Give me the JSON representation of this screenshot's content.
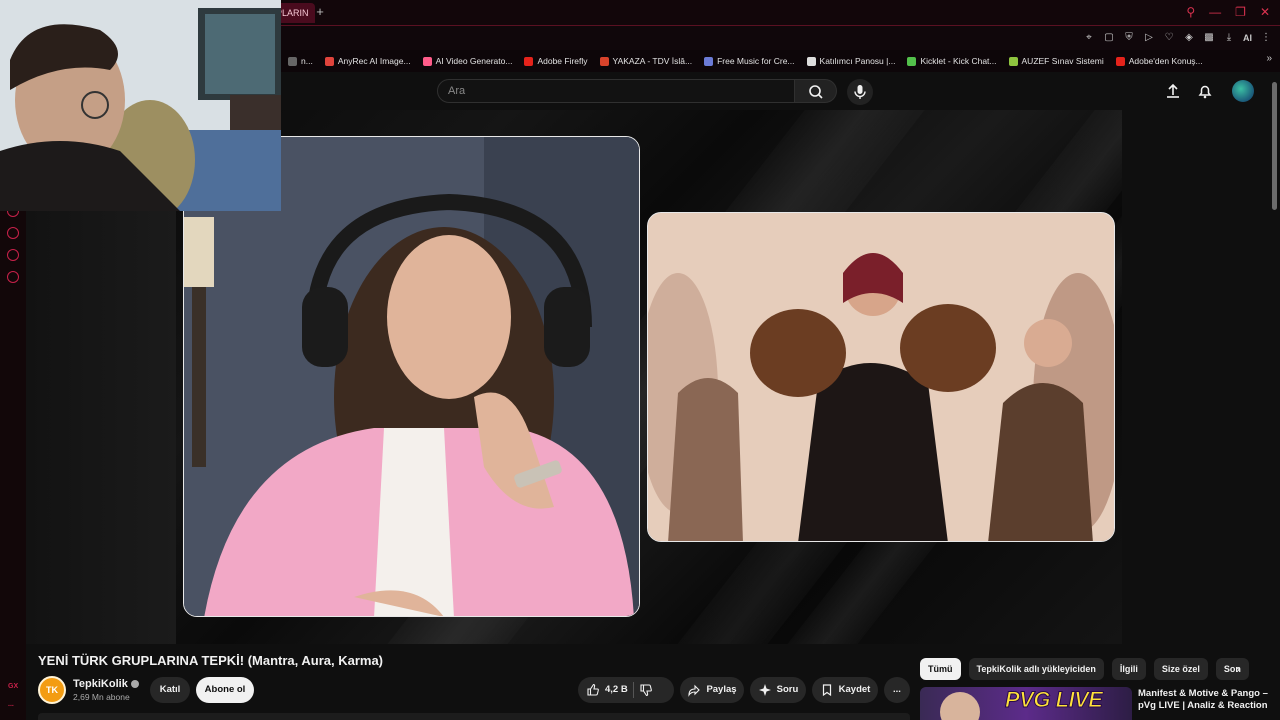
{
  "browser": {
    "active_tab_label": "PLARIN",
    "new_tab_label": "+",
    "bookmarks": [
      {
        "label": "n...",
        "color": "#666666"
      },
      {
        "label": "AnyRec AI Image...",
        "color": "#e0443c"
      },
      {
        "label": "AI Video Generato...",
        "color": "#ff5c8a"
      },
      {
        "label": "Adobe Firefly",
        "color": "#e5231b"
      },
      {
        "label": "YAKAZA - TDV İslâ...",
        "color": "#d9432b"
      },
      {
        "label": "Free Music for Cre...",
        "color": "#6b7bd6"
      },
      {
        "label": "Katılımcı Panosu |...",
        "color": "#dddddd"
      },
      {
        "label": "Kicklet - Kick Chat...",
        "color": "#53c04b"
      },
      {
        "label": "AUZEF Sınav Sistemi",
        "color": "#8fc43f"
      },
      {
        "label": "Adobe'den Konuş...",
        "color": "#e5231b"
      }
    ],
    "ai_label": "AI"
  },
  "left_rail": {
    "gx_label": "GX",
    "more_label": "..."
  },
  "youtube": {
    "search_placeholder": "Ara",
    "video_title": "YENİ TÜRK GRUPLARINA TEPKİ! (Mantra, Aura, Karma)",
    "channel": {
      "name": "TepkiKolik",
      "subscribers": "2,69 Mn abone",
      "avatar_text": "TK"
    },
    "join_label": "Katıl",
    "subscribe_label": "Abone ol",
    "like_count": "4,2 B",
    "share_label": "Paylaş",
    "ask_label": "Soru",
    "save_label": "Kaydet",
    "more_label": "...",
    "chips": [
      "Tümü",
      "TepkiKolik adlı yükleyiciden",
      "İlgili",
      "Size özel",
      "Son"
    ],
    "recommended": {
      "thumb_text": "PVG LIVE",
      "title": "Manifest & Motive & Pango – pVg LIVE | Analiz & Reaction"
    }
  },
  "colors": {
    "accent": "#c8214a",
    "background": "#0f0f0f",
    "chip_bg": "#272727"
  }
}
